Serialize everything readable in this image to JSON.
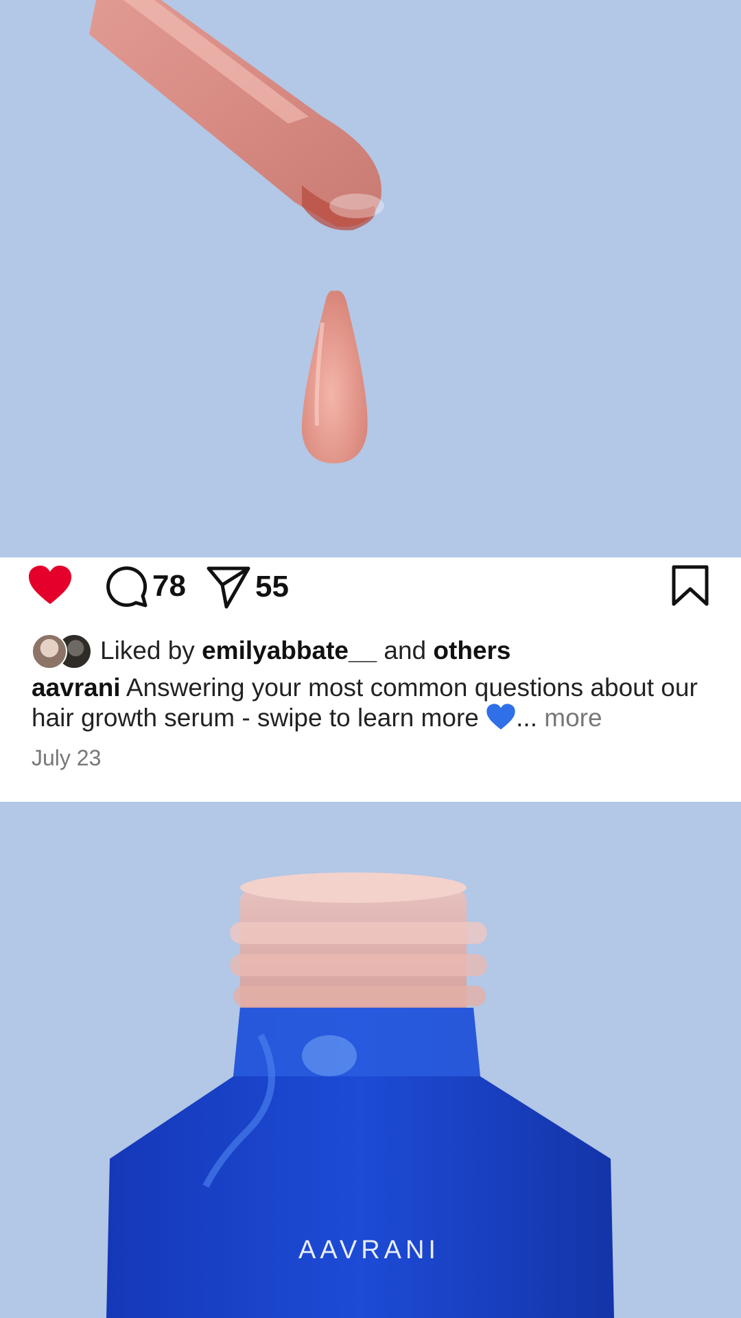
{
  "post": {
    "comments_count": "78",
    "shares_count": "55",
    "liked_prefix": "Liked by",
    "liked_user": "emilyabbate__",
    "liked_and": "and",
    "liked_others": "others",
    "author": "aavrani",
    "caption": "Answering your most common questions about our hair growth serum - swipe to learn more",
    "ellipsis": "...",
    "more_label": "more",
    "date": "July 23"
  },
  "brand": {
    "bottle_text": "AAVRANI"
  },
  "icons": {
    "like": "heart-icon",
    "comment": "comment-icon",
    "share": "send-icon",
    "save": "bookmark-icon",
    "caption_emoji": "blue-heart-icon"
  },
  "colors": {
    "photo_bg": "#b3c7e6",
    "like_red": "#e4002b",
    "serum_pink": "#e9a59a",
    "bottle_blue": "#1842c7",
    "emoji_blue": "#2f6fe8"
  }
}
